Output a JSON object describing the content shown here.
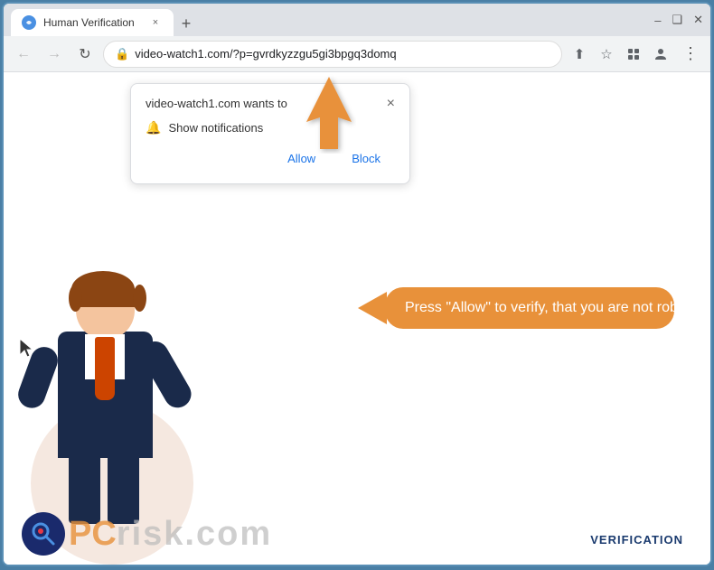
{
  "window": {
    "title": "Human Verification",
    "tab_close": "×"
  },
  "titleBar": {
    "controls": {
      "minimize": "–",
      "maximize": "❑",
      "close": "✕"
    },
    "newTab": "+"
  },
  "addressBar": {
    "back": "←",
    "forward": "→",
    "reload": "↻",
    "url": "video-watch1.com/?p=gvrdkyzzgu5gi3bpgq3domq",
    "share_icon": "⬆",
    "bookmark_icon": "☆",
    "extension_icon": "▭",
    "profile_icon": "👤",
    "menu_icon": "⋮"
  },
  "popup": {
    "title": "video-watch1.com wants to",
    "close": "×",
    "notification_label": "Show notifications",
    "allow_btn": "Allow",
    "block_btn": "Block"
  },
  "speech_bubble": {
    "text": "Press \"Allow\" to verify, that you are not robot"
  },
  "watermark": {
    "logo_text": "PC",
    "risk_text": "risk.com",
    "badge": "VERIFICATION"
  },
  "cursor": {
    "symbol": "↖"
  }
}
